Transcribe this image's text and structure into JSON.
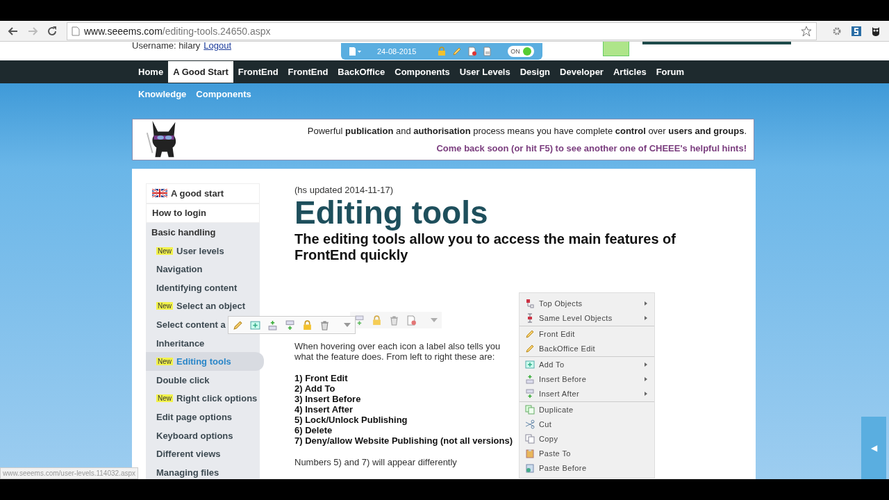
{
  "browser": {
    "url_host": "www.seeems.com",
    "url_path": "/editing-tools.24650.aspx"
  },
  "account": {
    "label": "Username: hilary",
    "logout": "Logout"
  },
  "edit_bar": {
    "date": "24-08-2015",
    "toggle": {
      "label": "ON",
      "on": true
    }
  },
  "nav": [
    {
      "label": "Home",
      "selected": false
    },
    {
      "label": "A Good Start",
      "selected": true
    },
    {
      "label": "FrontEnd",
      "selected": false
    },
    {
      "label": "FrontEnd",
      "selected": false
    },
    {
      "label": "BackOffice",
      "selected": false
    },
    {
      "label": "Components",
      "selected": false
    },
    {
      "label": "User Levels",
      "selected": false
    },
    {
      "label": "Design",
      "selected": false
    },
    {
      "label": "Developer",
      "selected": false
    },
    {
      "label": "Articles",
      "selected": false
    },
    {
      "label": "Forum",
      "selected": false
    }
  ],
  "subnav": [
    "Knowledge",
    "Components"
  ],
  "hint": {
    "text": "Powerful **publication** and **authorisation** process means you have complete **control** over **users and groups**.",
    "tip": "Come back soon (or hit F5) to see another one of CHEEE's helpful hints!"
  },
  "sidebar": [
    {
      "label": "A good start",
      "selected": false
    },
    {
      "label": "How to login",
      "selected": false
    },
    {
      "label": "Basic handling",
      "selected": false,
      "children": [
        {
          "label": "User levels",
          "badge": "New",
          "selected": false
        },
        {
          "label": "Navigation",
          "selected": false
        },
        {
          "label": "Identifying content",
          "selected": false
        },
        {
          "label": "Select an object",
          "badge": "New",
          "selected": false
        },
        {
          "label": "Select content a",
          "selected": false
        },
        {
          "label": "Inheritance",
          "selected": false
        },
        {
          "label": "Editing tools",
          "badge": "New",
          "selected": true
        },
        {
          "label": "Double click",
          "selected": false
        },
        {
          "label": "Right click options",
          "badge": "New",
          "selected": false
        },
        {
          "label": "Edit page options",
          "selected": false
        },
        {
          "label": "Keyboard options",
          "selected": false
        },
        {
          "label": "Different views",
          "selected": false
        },
        {
          "label": "Managing files",
          "selected": false
        }
      ]
    }
  ],
  "article": {
    "updated": "(hs updated 2014-11-17)",
    "title": "Editing tools",
    "subtitle": "The editing tools allow you to access the main features of FrontEnd quickly",
    "intro": "When hovering over each icon a label also tells you what the feature does. From left to right these are:",
    "features": [
      "1) Front Edit",
      "2) Add To",
      "3) Insert Before",
      "4) Insert After",
      "5) Lock/Unlock Publishing",
      "6) Delete",
      "7) Deny/allow Website Publishing (not all versions)"
    ],
    "note": "Numbers 5) and 7) will appear differently"
  },
  "context_menu": [
    {
      "label": "Top Objects",
      "submenu": true,
      "group_start": false
    },
    {
      "label": "Same Level Objects",
      "submenu": true,
      "group_start": false
    },
    {
      "label": "Front Edit",
      "submenu": false,
      "group_start": true
    },
    {
      "label": "BackOffice Edit",
      "submenu": false,
      "group_start": false
    },
    {
      "label": "Add To",
      "submenu": true,
      "group_start": true
    },
    {
      "label": "Insert Before",
      "submenu": true,
      "group_start": false
    },
    {
      "label": "Insert After",
      "submenu": true,
      "group_start": false
    },
    {
      "label": "Duplicate",
      "submenu": false,
      "group_start": true
    },
    {
      "label": "Cut",
      "submenu": false,
      "group_start": false
    },
    {
      "label": "Copy",
      "submenu": false,
      "group_start": false
    },
    {
      "label": "Paste To",
      "submenu": false,
      "group_start": false
    },
    {
      "label": "Paste Before",
      "submenu": false,
      "group_start": false
    }
  ],
  "side_tab": {
    "glyph": "◀"
  },
  "status_url": "www.seeems.com/user-levels.114032.aspx"
}
